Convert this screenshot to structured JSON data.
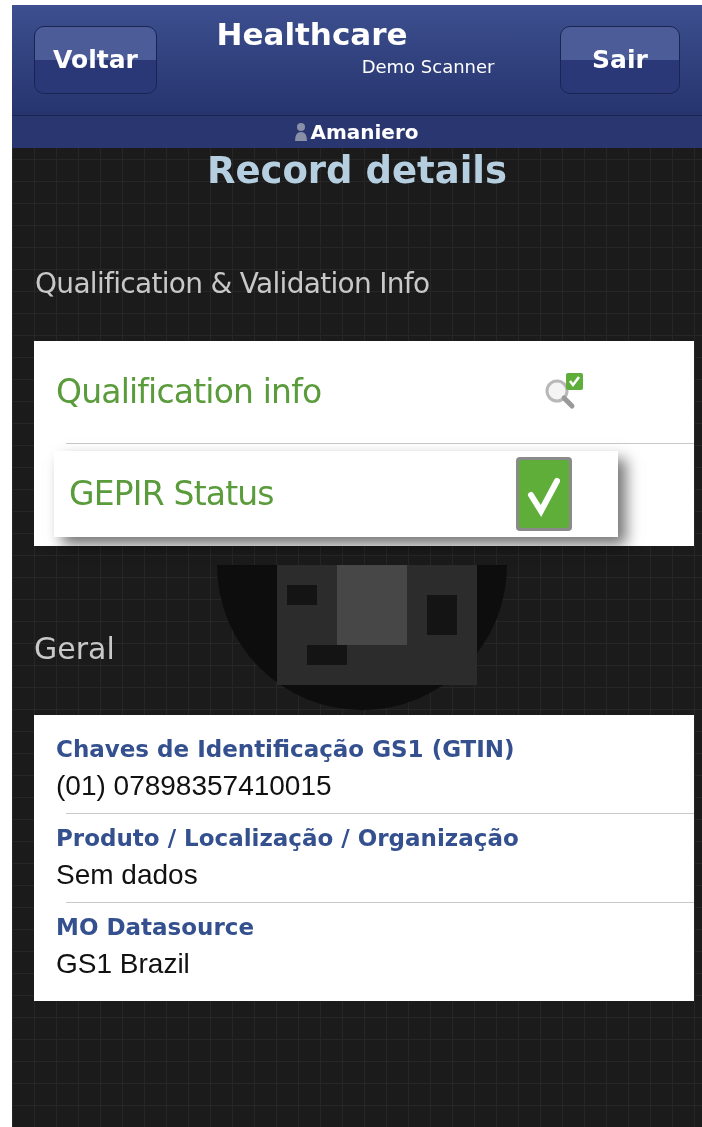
{
  "header": {
    "back_button": "Voltar",
    "title": "Healthcare",
    "subtitle": "Demo Scanner",
    "exit_button": "Sair"
  },
  "user_bar": {
    "username": "Amaniero"
  },
  "page_title": "Record details",
  "qualification_section": {
    "heading": "Qualification & Validation Info",
    "rows": [
      {
        "label": "Qualification info",
        "kind": "search",
        "selected": false
      },
      {
        "label": "GEPIR Status",
        "kind": "check",
        "selected": true
      }
    ]
  },
  "general_section": {
    "heading": "Geral",
    "fields": [
      {
        "label": "Chaves de Identificação GS1 (GTIN)",
        "value": "(01) 07898357410015"
      },
      {
        "label": "Produto / Localização / Organização",
        "value": "Sem dados"
      },
      {
        "label": "MO Datasource",
        "value": "GS1 Brazil"
      }
    ]
  }
}
